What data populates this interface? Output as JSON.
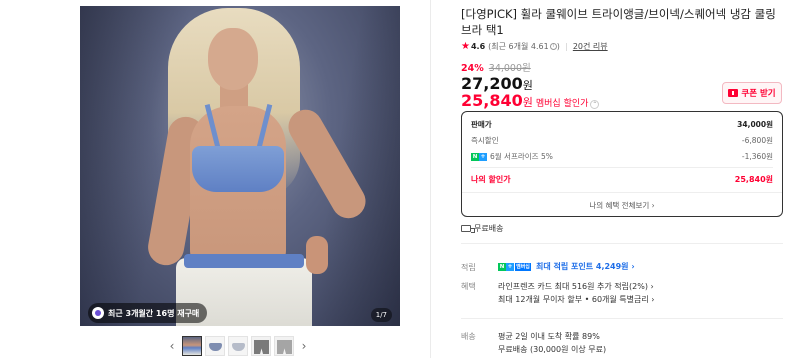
{
  "gallery": {
    "badge_text": "최근 3개월간 16명 재구매",
    "counter": "1/7",
    "prev_arrow": "‹",
    "next_arrow": "›",
    "thumb_count": 5
  },
  "product": {
    "title": "[다영PICK] 휠라 쿨웨이브 트라이앵글/브이넥/스퀘어넥 냉감 쿨링 브라 택1",
    "rating": "4.6",
    "rating_detail": "(최근 6개월 4.61",
    "rating_detail_close": ")",
    "review_link": "20건 리뷰",
    "discount_rate": "24%",
    "original_price": "34,000원",
    "price": "27,200",
    "price_unit": "원",
    "member_price": "25,840",
    "member_price_unit": "원",
    "member_label": "멤버십 할인가"
  },
  "coupon": {
    "label": "쿠폰 받기"
  },
  "price_box": {
    "rows": [
      {
        "label": "판매가",
        "value": "34,000원"
      },
      {
        "label": "즉시할인",
        "value": "-6,800원"
      },
      {
        "label": "6월 서프라이즈 5%",
        "value": "-1,360원"
      }
    ],
    "total_label": "나의 할인가",
    "total_value": "25,840원",
    "more_link": "나의 혜택 전체보기 ›"
  },
  "shipping_free": "무료배송",
  "benefits": {
    "accumulate_label": "적립",
    "accumulate_value": "최대 적립 포인트 4,249원 ›",
    "benefit_label": "혜택",
    "benefit_line1": "라인프렌즈 카드 최대 516원 추가 적립(2%) ›",
    "benefit_line2": "최대 12개월 무이자 할부 • 60개월 특별금리 ›",
    "delivery_label": "배송",
    "delivery_line1": "평균 2일 이내 도착 확률 89%",
    "delivery_line2": "무료배송 (30,000원 이상 무료)"
  },
  "icons": {
    "naver_plus_n": "N",
    "naver_plus_p": "+",
    "naver_plus_wide": "멤버십"
  },
  "colors": {
    "accent_red": "#ff0033",
    "naver_green": "#03c75a",
    "link_blue": "#1e6ee8"
  }
}
